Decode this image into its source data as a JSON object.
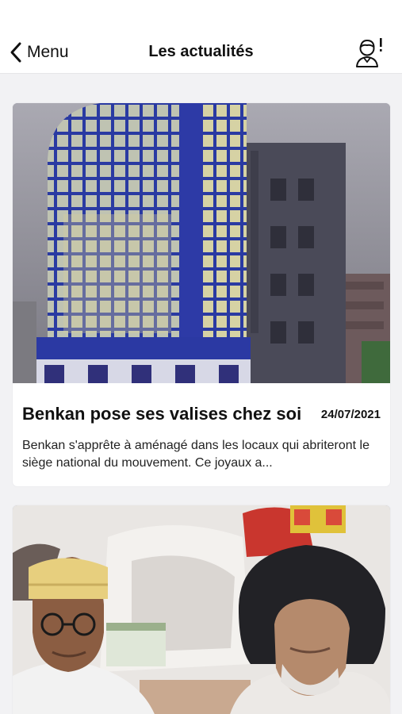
{
  "navbar": {
    "back_label": "Menu",
    "title": "Les actualités",
    "back_icon": "chevron-left-icon",
    "profile_icon": "user-alert-icon"
  },
  "articles": [
    {
      "title": "Benkan pose ses valises chez soi",
      "date": "24/07/2021",
      "excerpt": "Benkan s'apprête à aménagé dans les locaux qui abriteront le siège national du mouvement. Ce joyaux a...",
      "image": "building-photo"
    },
    {
      "image": "two-men-photo"
    }
  ],
  "colors": {
    "background": "#f2f2f4",
    "card": "#ffffff",
    "building_blue": "#2d3aa6"
  }
}
